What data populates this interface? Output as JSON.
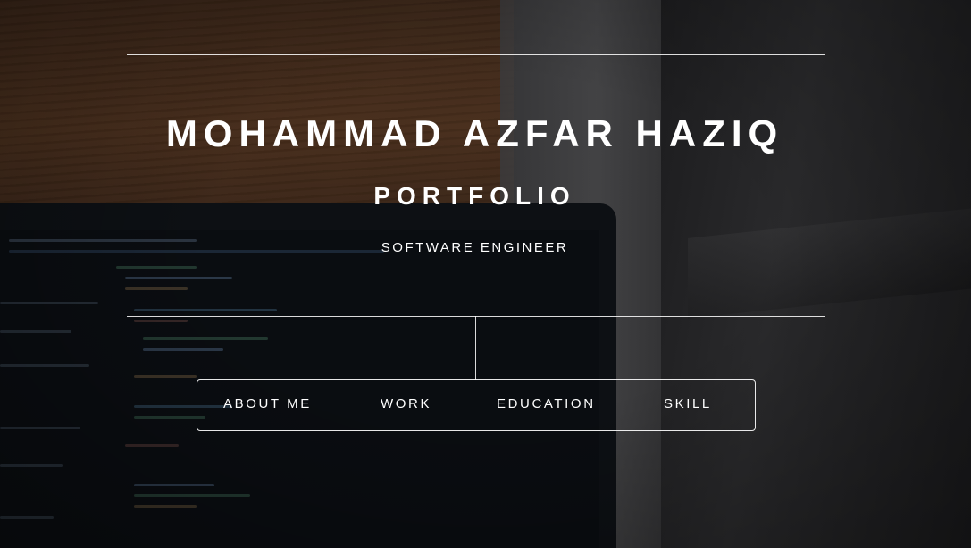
{
  "hero": {
    "name": "MOHAMMAD AZFAR HAZIQ",
    "subtitle": "PORTFOLIO",
    "role": "SOFTWARE ENGINEER"
  },
  "nav": {
    "items": [
      {
        "label": "ABOUT ME"
      },
      {
        "label": "WORK"
      },
      {
        "label": "EDUCATION"
      },
      {
        "label": "SKILL"
      }
    ]
  },
  "colors": {
    "text": "#ffffff",
    "rule": "#ffffff",
    "background": "#121212"
  }
}
